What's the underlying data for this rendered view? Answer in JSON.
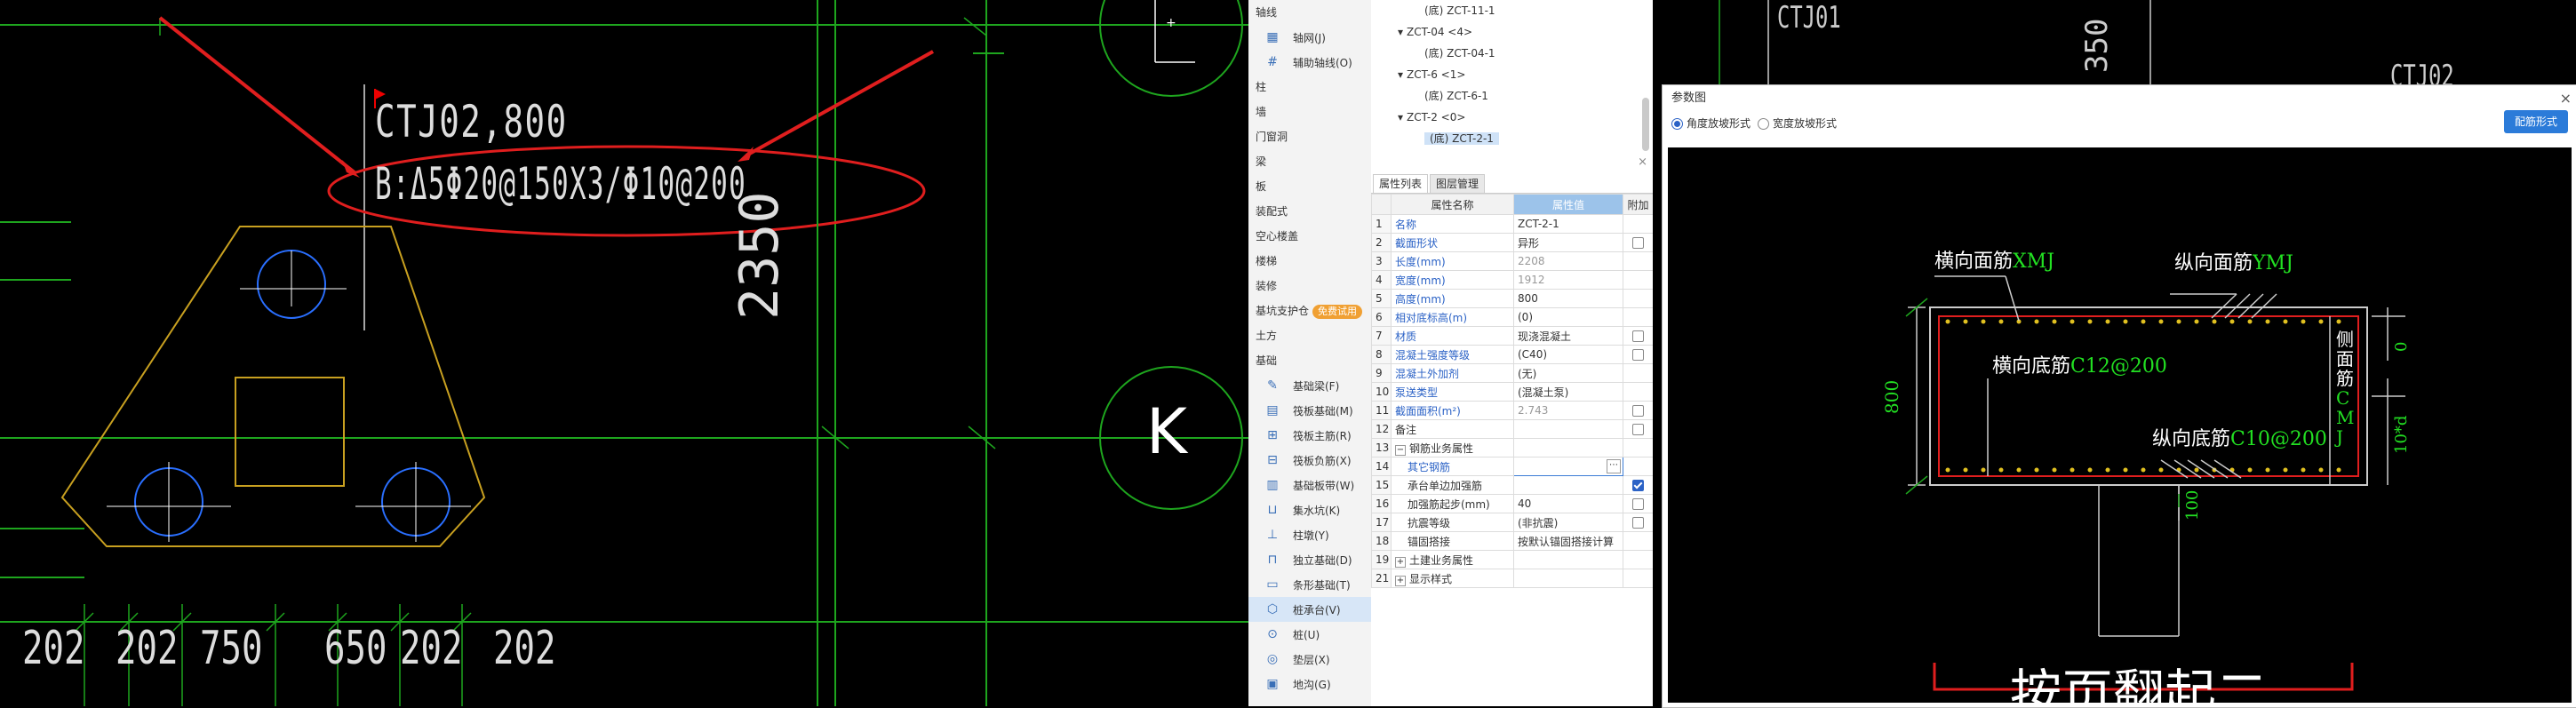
{
  "cad_left": {
    "annotation_line1": "CTJ02,800",
    "annotation_line2": "B:Δ5Φ20@150X3/Φ10@200",
    "dimension_vertical": "2350",
    "axis_label": "K",
    "bottom_dims": [
      "202",
      "202",
      "750",
      "650",
      "202",
      "202"
    ]
  },
  "sidebar": {
    "items": [
      {
        "type": "cat",
        "label": "轴线"
      },
      {
        "type": "sub",
        "label": "轴网(J)",
        "icon": "grid-icon"
      },
      {
        "type": "sub",
        "label": "辅助轴线(O)",
        "icon": "aux-axis-icon"
      },
      {
        "type": "cat",
        "label": "柱"
      },
      {
        "type": "cat",
        "label": "墙"
      },
      {
        "type": "cat",
        "label": "门窗洞"
      },
      {
        "type": "cat",
        "label": "梁"
      },
      {
        "type": "cat",
        "label": "板"
      },
      {
        "type": "cat",
        "label": "装配式"
      },
      {
        "type": "cat",
        "label": "空心楼盖"
      },
      {
        "type": "cat",
        "label": "楼梯"
      },
      {
        "type": "cat",
        "label": "装修"
      },
      {
        "type": "cat",
        "label": "基坑支护仓",
        "badge": "免费试用"
      },
      {
        "type": "cat",
        "label": "土方"
      },
      {
        "type": "cat",
        "label": "基础"
      },
      {
        "type": "sub",
        "label": "基础梁(F)",
        "icon": "pencil-icon"
      },
      {
        "type": "sub",
        "label": "筏板基础(M)",
        "icon": "raft-icon"
      },
      {
        "type": "sub",
        "label": "筏板主筋(R)",
        "icon": "raft-main-rebar-icon"
      },
      {
        "type": "sub",
        "label": "筏板负筋(X)",
        "icon": "raft-neg-rebar-icon"
      },
      {
        "type": "sub",
        "label": "基础板带(W)",
        "icon": "strip-icon"
      },
      {
        "type": "sub",
        "label": "集水坑(K)",
        "icon": "sump-icon"
      },
      {
        "type": "sub",
        "label": "柱墩(Y)",
        "icon": "pier-icon"
      },
      {
        "type": "sub",
        "label": "独立基础(D)",
        "icon": "isolated-footing-icon"
      },
      {
        "type": "sub",
        "label": "条形基础(T)",
        "icon": "strip-footing-icon"
      },
      {
        "type": "sub",
        "label": "桩承台(V)",
        "icon": "pile-cap-icon",
        "active": true
      },
      {
        "type": "sub",
        "label": "桩(U)",
        "icon": "pile-icon"
      },
      {
        "type": "sub",
        "label": "垫层(X)",
        "icon": "cushion-icon"
      },
      {
        "type": "sub",
        "label": "地沟(G)",
        "icon": "trench-icon"
      }
    ]
  },
  "tree": {
    "rows": [
      {
        "indent": 2,
        "label": "(底) ZCT-11-1"
      },
      {
        "indent": 1,
        "label": "ZCT-04 <4>",
        "expand": "▾"
      },
      {
        "indent": 2,
        "label": "(底) ZCT-04-1"
      },
      {
        "indent": 1,
        "label": "ZCT-6 <1>",
        "expand": "▾"
      },
      {
        "indent": 2,
        "label": "(底) ZCT-6-1"
      },
      {
        "indent": 1,
        "label": "ZCT-2 <0>",
        "expand": "▾"
      },
      {
        "indent": 2,
        "label": "(底) ZCT-2-1",
        "selected": true
      }
    ]
  },
  "props": {
    "close": "×",
    "tabs": [
      "属性列表",
      "图层管理"
    ],
    "headers": [
      "属性名称",
      "属性值",
      "附加"
    ],
    "rows": [
      {
        "n": "1",
        "name": "名称",
        "value": "ZCT-2-1",
        "nameColor": "blue",
        "check": ""
      },
      {
        "n": "2",
        "name": "截面形状",
        "value": "异形",
        "nameColor": "blue",
        "check": "off"
      },
      {
        "n": "3",
        "name": "长度(mm)",
        "value": "2208",
        "nameColor": "blue",
        "valueColor": "gray",
        "check": ""
      },
      {
        "n": "4",
        "name": "宽度(mm)",
        "value": "1912",
        "nameColor": "blue",
        "valueColor": "gray",
        "check": ""
      },
      {
        "n": "5",
        "name": "高度(mm)",
        "value": "800",
        "nameColor": "blue",
        "check": ""
      },
      {
        "n": "6",
        "name": "相对底标高(m)",
        "value": "(0)",
        "nameColor": "blue",
        "check": ""
      },
      {
        "n": "7",
        "name": "材质",
        "value": "现浇混凝土",
        "nameColor": "blue",
        "check": "off"
      },
      {
        "n": "8",
        "name": "混凝土强度等级",
        "value": "(C40)",
        "nameColor": "blue",
        "check": "off"
      },
      {
        "n": "9",
        "name": "混凝土外加剂",
        "value": "(无)",
        "nameColor": "blue",
        "check": ""
      },
      {
        "n": "10",
        "name": "泵送类型",
        "value": "(混凝土泵)",
        "nameColor": "blue",
        "check": ""
      },
      {
        "n": "11",
        "name": "截面面积(m²)",
        "value": "2.743",
        "nameColor": "blue",
        "valueColor": "gray",
        "check": "off"
      },
      {
        "n": "12",
        "name": "备注",
        "value": "",
        "check": "off"
      },
      {
        "n": "13",
        "name": "钢筋业务属性",
        "value": "",
        "group": "−",
        "check": ""
      },
      {
        "n": "14",
        "name": "其它钢筋",
        "value": "",
        "nameColor": "blue",
        "indent": true,
        "edit": true,
        "check": ""
      },
      {
        "n": "15",
        "name": "承台单边加强筋",
        "value": "",
        "indent": true,
        "check": "on"
      },
      {
        "n": "16",
        "name": "加强筋起步(mm)",
        "value": "40",
        "indent": true,
        "check": "off"
      },
      {
        "n": "17",
        "name": "抗震等级",
        "value": "(非抗震)",
        "indent": true,
        "check": "off"
      },
      {
        "n": "18",
        "name": "锚固搭接",
        "value": "按默认锚固搭接计算",
        "indent": true,
        "check": ""
      },
      {
        "n": "19",
        "name": "土建业务属性",
        "value": "",
        "group": "+",
        "check": ""
      },
      {
        "n": "21",
        "name": "显示样式",
        "value": "",
        "group": "+",
        "check": ""
      }
    ]
  },
  "cad_right": {
    "top_text": "CTJ01",
    "dim_text": "350",
    "right_text": "CTJ02"
  },
  "dialog": {
    "title": "参数图",
    "close": "×",
    "radio1": "角度放坡形式",
    "radio2": "宽度放坡形式",
    "button": "配筋形式",
    "diagram": {
      "label_top_left_cn": "横向面筋",
      "label_top_left_code": "XMJ",
      "label_top_right_cn": "纵向面筋",
      "label_top_right_code": "YMJ",
      "label_mid_cn": "横向底筋",
      "label_mid_code": "C12@200",
      "label_bot_cn": "纵向底筋",
      "label_bot_code": "C10@200",
      "side_cn": "侧面筋",
      "side_code": "CMJ",
      "dim_height": "800",
      "dim_zero": "0",
      "dim_10d": "10*d",
      "dim_100": "100",
      "bottom_title": "按页翻起二"
    }
  }
}
